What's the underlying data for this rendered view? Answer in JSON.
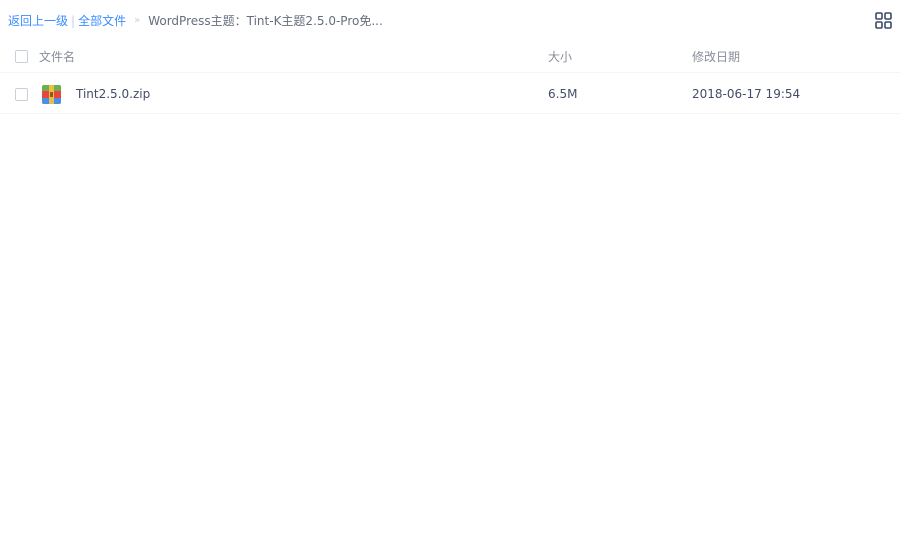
{
  "breadcrumb": {
    "back_label": "返回上一级",
    "separator": "|",
    "all_files_label": "全部文件",
    "arrow": "»",
    "current_label": "WordPress主题：Tint-K主题2.5.0-Pro免..."
  },
  "colors": {
    "link": "#3b8cff",
    "text": "#424e67",
    "header_text": "#888e99",
    "divider": "#f2f4f8"
  },
  "table": {
    "headers": {
      "name": "文件名",
      "size": "大小",
      "modified": "修改日期"
    },
    "rows": [
      {
        "icon": "zip-archive-icon",
        "name": "Tint2.5.0.zip",
        "size": "6.5M",
        "modified": "2018-06-17 19:54"
      }
    ]
  },
  "toolbar": {
    "view_toggle_icon": "grid-view-icon"
  }
}
